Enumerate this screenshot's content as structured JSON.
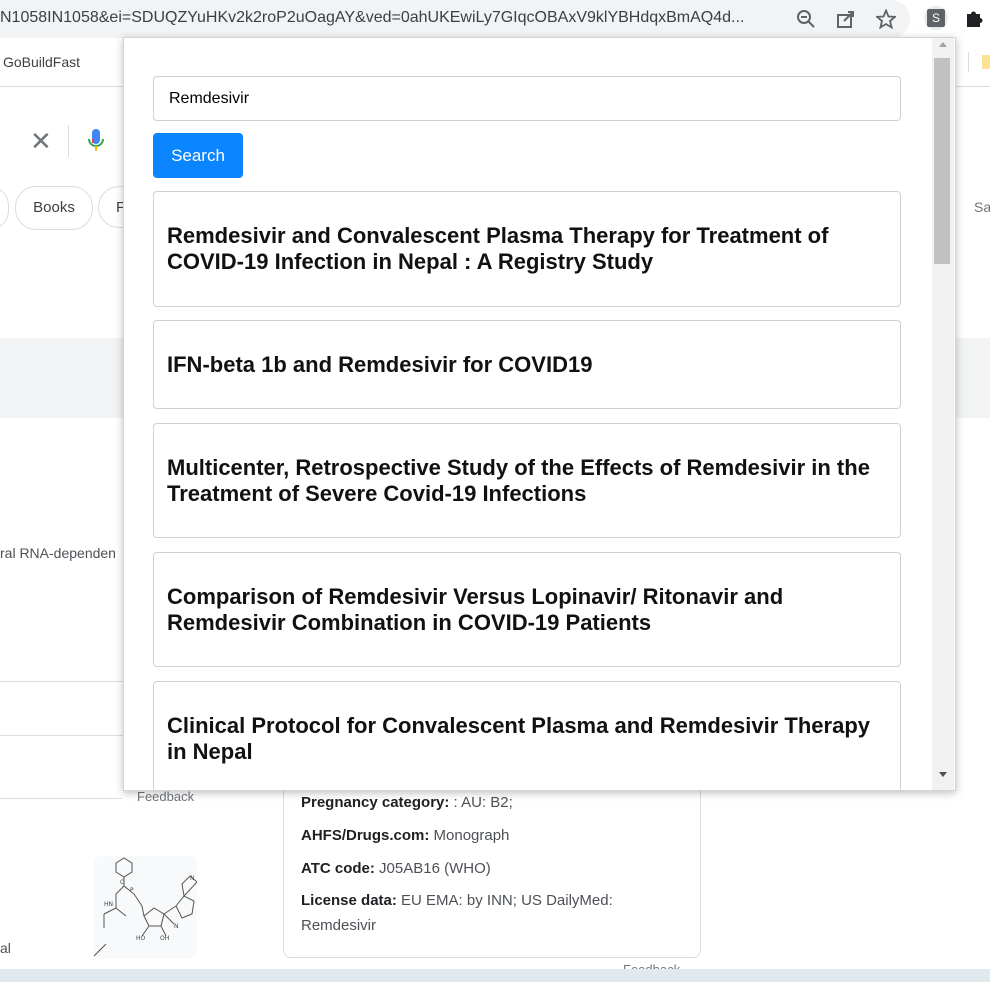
{
  "browser": {
    "url": "N1058IN1058&ei=SDUQZYuHKv2k2roP2uOagAY&ved=0ahUKEwiLy7GIqcOBAxV9klYBHdqxBmAQ4d...",
    "extension_letter": "S",
    "bookmark": "GoBuildFast"
  },
  "google": {
    "chips": [
      "Books",
      "F"
    ],
    "side_text": "Sa",
    "rna_text": "ral RNA-dependen",
    "feedback": "Feedback",
    "al_text": "al",
    "info": {
      "pregnancy_label": "Pregnancy category:",
      "pregnancy_value": " : AU: B2;",
      "ahfs_label": "AHFS/Drugs.com:",
      "ahfs_value": " Monograph",
      "atc_label": "ATC code:",
      "atc_value": " J05AB16 (WHO)",
      "license_label": "License data:",
      "license_value": " EU EMA: by INN; US DailyMed:",
      "license_value2": "Remdesivir"
    }
  },
  "popup": {
    "search_value": "Remdesivir",
    "search_button": "Search",
    "results": [
      "Remdesivir and Convalescent Plasma Therapy for Treatment of COVID-19 Infection in Nepal : A Registry Study",
      "IFN-beta 1b and Remdesivir for COVID19",
      "Multicenter, Retrospective Study of the Effects of Remdesivir in the Treatment of Severe Covid-19 Infections",
      "Comparison of Remdesivir Versus Lopinavir/ Ritonavir and Remdesivir Combination in COVID-19 Patients",
      "Clinical Protocol for Convalescent Plasma and Remdesivir Therapy in Nepal"
    ]
  },
  "icons": {
    "zoom": "magnifier-minus-icon",
    "share": "share-icon",
    "bookmark_star": "star-icon",
    "extensions": "puzzle-icon",
    "clear": "close-icon",
    "voice": "mic-icon"
  }
}
